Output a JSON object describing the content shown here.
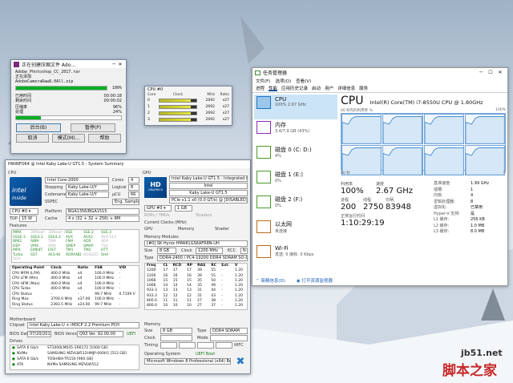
{
  "watermark": {
    "site": "jb51.net",
    "brand": "脚本之家"
  },
  "zip": {
    "title": "正在创建压缩文件 Ado...",
    "file_line": "Adobe_Photoshop_CC_2017.rar",
    "adding": "正在添加",
    "adding_file": "AdobeCameraRaw8.0All.zip",
    "pct1": "100%",
    "elapsed_label": "已用时间",
    "elapsed": "00:00:18",
    "remain_label": "剩余时间",
    "remain": "00:00:02",
    "ratio_label": "压缩率",
    "ratio": "96%",
    "processed_label": "处理",
    "processed": "24%",
    "buttons": [
      "后台(B)",
      "暂停(P)",
      "取消",
      "模式(M)...",
      "帮助"
    ],
    "progress1": 1.0,
    "progress2": 0.24
  },
  "cpumon": {
    "title": "CPU #0",
    "headers": [
      "Core",
      "Clock",
      "MHz",
      "Ratio"
    ],
    "rows": [
      {
        "core": "0",
        "mhz": "2692",
        "ratio": "x27",
        "load": 0.85
      },
      {
        "core": "1",
        "mhz": "2692",
        "ratio": "x27",
        "load": 0.85
      },
      {
        "core": "2",
        "mhz": "2692",
        "ratio": "x27",
        "load": 0.85
      },
      {
        "core": "3",
        "mhz": "2692",
        "ratio": "x27",
        "load": 0.85
      }
    ]
  },
  "hwinfo": {
    "title": "HWiNFO64 @ Intel Kaby Lake-U GT1.5 - System Summary",
    "cpu_section": "CPU",
    "gpu_section": "GPU",
    "cpu_name": "Intel Core-2000",
    "cores_label": "Cores",
    "cores": "4",
    "stepping_label": "Stepping",
    "stepping": "Kaby Lake-U/Y",
    "logical_label": "Logical",
    "logical": "8",
    "codename_label": "Codename",
    "codename": "Kaby Lake-U/Y",
    "ucu_label": "µCU",
    "ucu": "66",
    "sspec_label": "SSPEC",
    "sspec": "Eng. Sample",
    "cpu_select": "CPU #0",
    "platform_label": "Platform",
    "platform": "BGA1356/BGA1515",
    "tdp_label": "TDP",
    "tdp": "15 W",
    "cache_label": "Cache",
    "cache": "4 x (32 + 32 + 256) + 8M",
    "features_label": "Features",
    "features": [
      "MMX",
      "3DNow!",
      "3DNow!-2",
      "SSE",
      "SSE-2",
      "SSE-3",
      "SSSE-3",
      "SSE4.1",
      "SSE4.2",
      "AVX",
      "AVX2",
      "AVX-512",
      "BMI2",
      "ABM",
      "TBM",
      "FMA",
      "ADX",
      "XOP",
      "DEP",
      "VMX",
      "SMX",
      "SMEP",
      "SMAP",
      "TSX",
      "MPX",
      "EM64T",
      "EIST",
      "TM1",
      "TM2",
      "HTT",
      "Turbo",
      "SST",
      "AES-NI",
      "RDRAND",
      "RDSEED",
      "SHA",
      "SGX"
    ],
    "features_off": [
      1,
      2,
      11,
      14,
      17,
      20,
      23,
      34,
      36
    ],
    "op_headers": [
      "Operating Point",
      "Clock",
      "Ratio",
      "FSB",
      "VID"
    ],
    "op_rows": [
      [
        "CPU MFM (LFM)",
        "400.0 MHz",
        "x4",
        "100.0 MHz",
        "-"
      ],
      [
        "CPU LFM (Min)",
        "400.0 MHz",
        "x4",
        "100.0 MHz",
        "-"
      ],
      [
        "CPU HFM (Max)",
        "400.0 MHz",
        "x4",
        "100.0 MHz",
        "-"
      ],
      [
        "CPU Turbo",
        "400.0 MHz",
        "x4",
        "100.0 MHz",
        "-"
      ],
      [
        "CPU Status",
        "-",
        "-",
        "99.7 MHz",
        "0.7109 V"
      ],
      [
        "Ring Max",
        "3700.0 MHz",
        "x37.00",
        "100.0 MHz",
        "-"
      ],
      [
        "Ring Status",
        "2393.5 MHz",
        "x24.00",
        "99.7 MHz",
        "-"
      ]
    ],
    "mb_label": "Motherboard",
    "chipset_label": "Chipset",
    "chipset": "Intel Kaby Lake-U + iHDCP 2.2 Premium PCH",
    "bios_date_label": "BIOS Date",
    "bios_date": "07/20/2017",
    "bios_ver_label": "BIOS Version",
    "bios_ver": "Q93 Ver. 92.00.00",
    "uefi": "UEFI",
    "drives_label": "Drives",
    "drives": [
      {
        "iface": "SATA 6 Gb/s",
        "name": "ST1000LM035-1RK172 [1000 GB]"
      },
      {
        "iface": "NVMe",
        "name": "SAMSUNG MZVLW512HMJP-000H1 [512 GB]"
      },
      {
        "iface": "SATA 6 Gb/s",
        "name": "TOSHIBA-TR150 [960 GB]"
      },
      {
        "iface": "ATA",
        "name": "NVMe SAMSUNG MZVLW512"
      }
    ],
    "gpu_name": "Intel Kaby Lake-U GT1.5 - Integrated Graphics",
    "gpu_vendor": "Intel",
    "gpu_code": "Kaby Lake-U GT1.5",
    "gpu_bus": "PCIe v1.1 x0 (0.0 GT/s) @ [DISABLED]",
    "gpu_select": "GPU #0",
    "gpu_mem": "1 GB",
    "gpu_rows": [
      "ROPs / TMUs",
      "Shaders"
    ],
    "cur_clocks_label": "Current Clocks (MHz)",
    "cur_clock_labels": [
      "GPU",
      "Memory",
      "Shader"
    ],
    "mem_modules_label": "Memory Modules",
    "mem_module": "[#0] SK Hynix HMA81GS6AFR8N-UH",
    "mem_head": [
      "Size",
      "Clock",
      "ECC"
    ],
    "mem_size": "8 GB",
    "mem_clock": "1200 MHz",
    "mem_ecc": "N",
    "mem_type_label": "Type",
    "mem_type": "DDR4-2400 / PC4-19200 DDR4 SDRAM SO-DIMM",
    "timing_headers": [
      "Freq",
      "CL",
      "RCD",
      "RP",
      "RAS",
      "RC",
      "Ext.",
      "V"
    ],
    "timing_rows": [
      [
        "1200",
        "17",
        "17",
        "17",
        "39",
        "55",
        "-",
        "1.20"
      ],
      [
        "1200",
        "16",
        "16",
        "16",
        "39",
        "55",
        "-",
        "1.20"
      ],
      [
        "1066",
        "15",
        "15",
        "15",
        "35",
        "50",
        "-",
        "1.20"
      ],
      [
        "1066",
        "14",
        "14",
        "14",
        "35",
        "49",
        "-",
        "1.20"
      ],
      [
        "933.3",
        "13",
        "13",
        "13",
        "31",
        "44",
        "-",
        "1.20"
      ],
      [
        "933.3",
        "12",
        "12",
        "12",
        "31",
        "43",
        "-",
        "1.20"
      ],
      [
        "800.0",
        "11",
        "11",
        "11",
        "27",
        "38",
        "-",
        "1.20"
      ],
      [
        "800.0",
        "10",
        "10",
        "10",
        "27",
        "37",
        "-",
        "1.20"
      ]
    ],
    "memory_label": "Memory",
    "m_size_label": "Size",
    "m_size": "8 GB",
    "m_type_label": "Type",
    "m_type": "DDR4 SDRAM",
    "m_clock_label": "Clock",
    "m_mode_label": "Mode",
    "m_timing_label": "Timing",
    "trfc": "tRFC",
    "os_label": "Operating System",
    "os_boot": "UEFI Boot",
    "os": "Microsoft Windows 8 Professional (x64) Build 9200"
  },
  "taskmgr": {
    "title": "任务管理器",
    "menu": [
      "文件(F)",
      "选项(O)",
      "查看(V)"
    ],
    "tabs": [
      "进程",
      "性能",
      "应用历史记录",
      "启动",
      "用户",
      "详细信息",
      "服务"
    ],
    "side": [
      {
        "title": "CPU",
        "sub": "100% 2.67 GHz"
      },
      {
        "title": "内存",
        "sub": "3.4/7.9 GB (43%)"
      },
      {
        "title": "磁盘 0 (C: D:)",
        "sub": "4%"
      },
      {
        "title": "磁盘 1 (E:)",
        "sub": "0%"
      },
      {
        "title": "磁盘 2 (F:)",
        "sub": "0%"
      },
      {
        "title": "以太网",
        "sub": "未连接"
      },
      {
        "title": "Wi-Fi",
        "sub": "发送: 0 接收: 0 Kbps"
      }
    ],
    "cpu_big": "CPU",
    "cpu_model": "Intel(R) Core(TM) i7-8550U CPU @ 1.80GHz",
    "graph_caption": "60 秒内的利用率 %",
    "graph_max": "100%",
    "graph_time": "60 秒",
    "graph_min": "0",
    "util_label": "利用率",
    "util": "100%",
    "speed_label": "速度",
    "speed": "2.67 GHz",
    "proc_label": "进程",
    "proc": "200",
    "threads_label": "线程",
    "threads": "2750",
    "handles_label": "句柄",
    "handles": "83948",
    "uptime_label": "正常运行时间",
    "uptime": "1:10:29:19",
    "right_labels": [
      "基准速度:",
      "插槽:",
      "内核:",
      "逻辑处理器:",
      "虚拟化:",
      "Hyper-V 支持:",
      "L1 缓存:",
      "L2 缓存:",
      "L3 缓存:"
    ],
    "right_values": [
      "1.99 GHz",
      "1",
      "4",
      "8",
      "已禁用",
      "是",
      "256 KB",
      "1.0 MB",
      "8.0 MB"
    ],
    "less": "简略信息(D)",
    "open_rm": "打开资源监视器"
  }
}
